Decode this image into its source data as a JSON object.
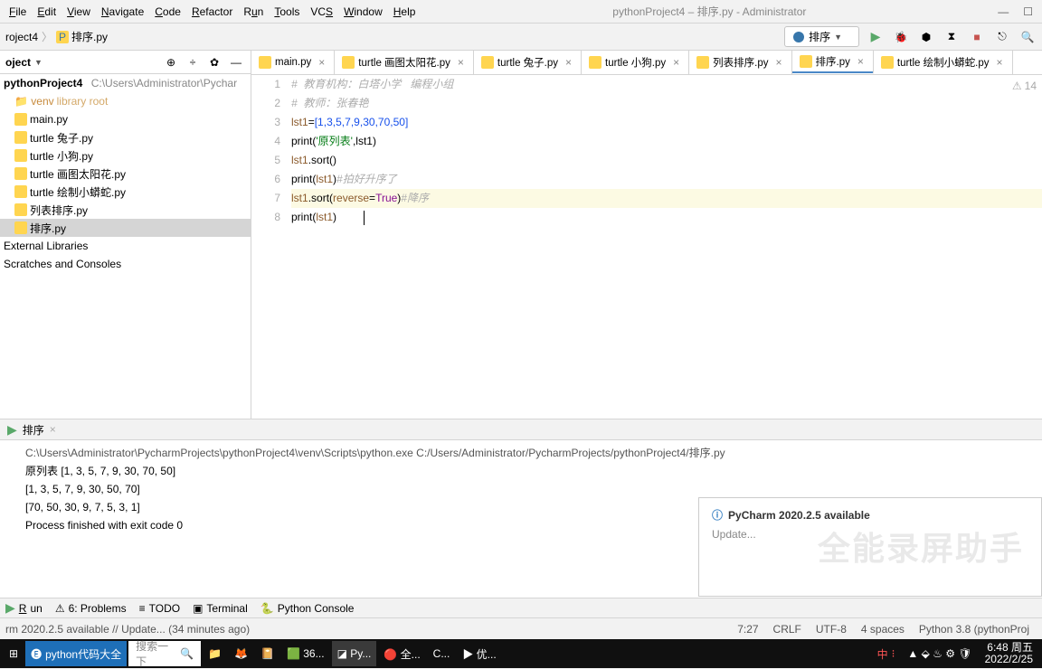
{
  "menu": {
    "items": [
      "File",
      "Edit",
      "View",
      "Navigate",
      "Code",
      "Refactor",
      "Run",
      "Tools",
      "VCS",
      "Window",
      "Help"
    ]
  },
  "title": "pythonProject4 – 排序.py - Administrator",
  "breadcrumb": {
    "project": "roject4",
    "file": "排序.py"
  },
  "run_config": "排序",
  "sidebar": {
    "title": "oject",
    "root": "pythonProject4",
    "root_path": "C:\\Users\\Administrator\\Pychar",
    "items": [
      {
        "name": "venv",
        "lib": "library root"
      },
      {
        "name": "main.py"
      },
      {
        "name": "turtle 兔子.py"
      },
      {
        "name": "turtle 小狗.py"
      },
      {
        "name": "turtle 画图太阳花.py"
      },
      {
        "name": "turtle 绘制小蟒蛇.py"
      },
      {
        "name": "列表排序.py"
      },
      {
        "name": "排序.py",
        "sel": true
      }
    ],
    "ext": "External Libraries",
    "scratch": "Scratches and Consoles"
  },
  "tabs": [
    {
      "label": "main.py"
    },
    {
      "label": "turtle 画图太阳花.py"
    },
    {
      "label": "turtle 兔子.py"
    },
    {
      "label": "turtle 小狗.py"
    },
    {
      "label": "列表排序.py"
    },
    {
      "label": "排序.py",
      "active": true
    },
    {
      "label": "turtle 绘制小蟒蛇.py"
    }
  ],
  "code": {
    "warn": "14",
    "lines": [
      {
        "n": 1,
        "raw": "#  教育机构：白塔小学   编程小组",
        "comment": true
      },
      {
        "n": 2,
        "raw": "#  教师：张春艳",
        "comment": true
      },
      {
        "n": 3,
        "lst": "lst1",
        "nums": "[1,3,5,7,9,30,70,50]"
      },
      {
        "n": 4,
        "print_str": "'原列表'",
        "print_arg": ",lst1"
      },
      {
        "n": 5,
        "call": "lst1.sort()"
      },
      {
        "n": 6,
        "print_arg": "lst1",
        "tail": "#拍好升序了"
      },
      {
        "n": 7,
        "hl": true,
        "sort_rev": "lst1.sort(reverse=True)",
        "tail": "#降序"
      },
      {
        "n": 8,
        "print_arg": "lst1",
        "caret": true
      }
    ]
  },
  "run_tab": "排序",
  "console": {
    "cmd": "C:\\Users\\Administrator\\PycharmProjects\\pythonProject4\\venv\\Scripts\\python.exe C:/Users/Administrator/PycharmProjects/pythonProject4/排序.py",
    "out": [
      "原列表 [1, 3, 5, 7, 9, 30, 70, 50]",
      "[1, 3, 5, 7, 9, 30, 50, 70]",
      "[70, 50, 30, 9, 7, 5, 3, 1]",
      "",
      "Process finished with exit code 0"
    ]
  },
  "bottom_tabs": {
    "run": "Run",
    "problems": "6: Problems",
    "todo": "TODO",
    "terminal": "Terminal",
    "pyconsole": "Python Console"
  },
  "status": {
    "left": "rm 2020.2.5 available // Update... (34 minutes ago)",
    "caret": "7:27",
    "eol": "CRLF",
    "enc": "UTF-8",
    "indent": "4 spaces",
    "py": "Python 3.8 (pythonProj"
  },
  "notif": {
    "title": "PyCharm 2020.2.5 available",
    "link": "Update..."
  },
  "taskbar": {
    "browser": "python代码大全",
    "search_ph": "搜索一下",
    "apps": [
      "36...",
      "Py...",
      "全...",
      "C...",
      "优..."
    ],
    "ime": "中",
    "clock_time": "6:48 周五",
    "clock_date": "2022/2/25"
  }
}
